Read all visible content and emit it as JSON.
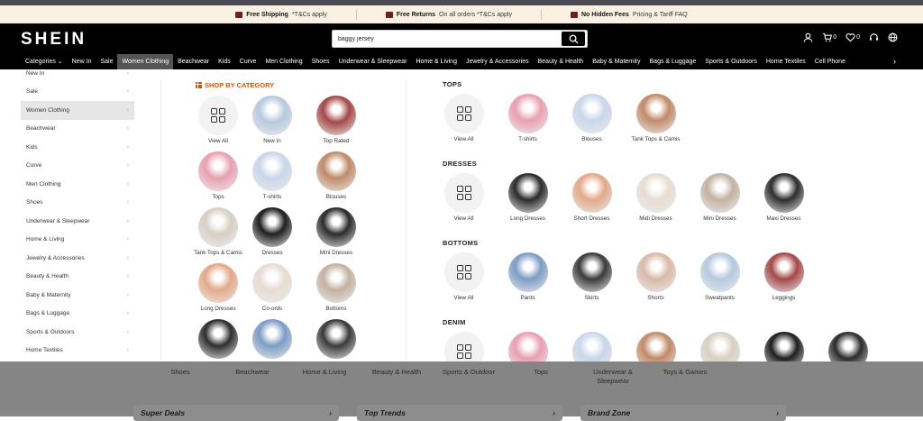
{
  "promo": [
    {
      "title": "Free Shipping",
      "note": "*T&Cs apply"
    },
    {
      "title": "Free Returns",
      "note": "On all orders *T&Cs apply"
    },
    {
      "title": "No Hidden Fees",
      "note": "Pricing & Tariff FAQ"
    }
  ],
  "header": {
    "logo": "SHEIN",
    "search_value": "baggy jersey",
    "cart_count": "0",
    "wishlist_count": "0"
  },
  "nav": {
    "items": [
      "Categories ⌄",
      "New In",
      "Sale",
      "Women Clothing",
      "Beachwear",
      "Kids",
      "Curve",
      "Men Clothing",
      "Shoes",
      "Underwear & Sleepwear",
      "Home & Living",
      "Jewelry & Accessories",
      "Beauty & Health",
      "Baby & Maternity",
      "Bags & Luggage",
      "Sports & Outdoors",
      "Home Textiles",
      "Cell Phone"
    ],
    "more": "›"
  },
  "sidebar": {
    "items": [
      "New In",
      "Sale",
      "Women Clothing",
      "Beachwear",
      "Kids",
      "Curve",
      "Men Clothing",
      "Shoes",
      "Underwear & Sleepwear",
      "Home & Living",
      "Jewelry & Accessories",
      "Beauty & Health",
      "Baby & Maternity",
      "Bags & Luggage",
      "Sports & Outdoors",
      "Home Textiles"
    ]
  },
  "shop_by_category": {
    "title": "SHOP BY CATEGORY",
    "tiles": [
      "View All",
      "New In",
      "Top Rated",
      "Tops",
      "T-shirts",
      "Blouses",
      "Tank Tops & Camis",
      "Dresses",
      "Mini Dresses",
      "Long Dresses",
      "Co-ords",
      "Bottoms",
      "",
      "",
      ""
    ]
  },
  "sections": [
    {
      "title": "TOPS",
      "items": [
        "View All",
        "T-shirts",
        "Blouses",
        "Tank Tops & Camis"
      ]
    },
    {
      "title": "DRESSES",
      "items": [
        "View All",
        "Long Dresses",
        "Short Dresses",
        "Midi Dresses",
        "Mini Dresses",
        "Maxi Dresses"
      ]
    },
    {
      "title": "BOTTOMS",
      "items": [
        "View All",
        "Pants",
        "Skirts",
        "Shorts",
        "Sweatpants",
        "Leggings"
      ]
    },
    {
      "title": "DENIM",
      "items": [
        "",
        "",
        "",
        "",
        "",
        "",
        ""
      ]
    }
  ],
  "overlay": {
    "categories": [
      "Shoes",
      "Beachwear",
      "Home & Living",
      "Beauty & Health",
      "Sports & Outdoor",
      "Tops",
      "Underwear & Sleepwear",
      "Toys & Games"
    ],
    "cards": [
      "Super Deals",
      "Top Trends",
      "Brand Zone"
    ]
  }
}
